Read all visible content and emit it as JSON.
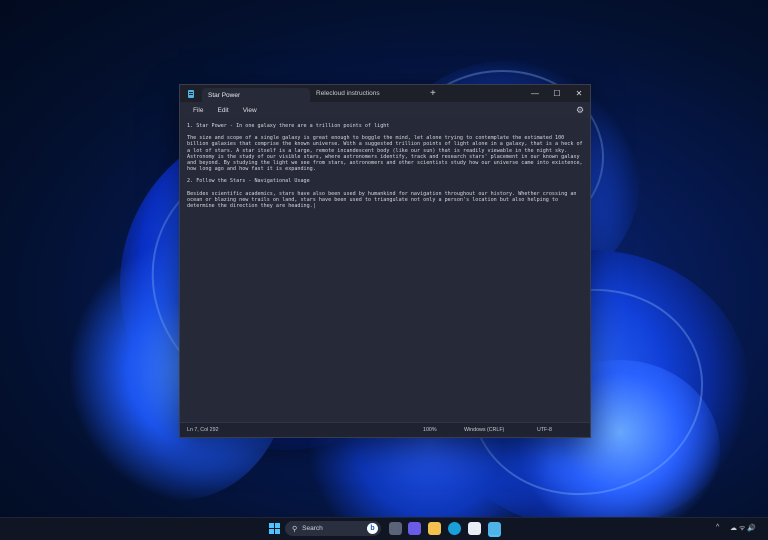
{
  "window": {
    "tabs": [
      {
        "label": "Star Power",
        "active": true
      },
      {
        "label": "Relecloud instructions",
        "active": false
      }
    ],
    "new_tab": "+",
    "controls": {
      "minimize": "—",
      "maximize": "☐",
      "close": "✕"
    }
  },
  "menu": [
    "File",
    "Edit",
    "View"
  ],
  "settings_icon": "⚙",
  "document": {
    "paragraphs": [
      "1. Star Power - In one galaxy there are a trillion points of light",
      "The size and scope of a single galaxy is great enough to boggle the mind, let alone trying to contemplate the estimated 100 billion galaxies that comprise the known universe. With a suggested trillion points of light alone in a galaxy, that is a heck of a lot of stars. A star itself is a large, remote incandescent body (like our sun) that is readily viewable in the night sky. Astronomy is the study of our visible stars, where astronomers identify, track and research stars' placement in our known galaxy and beyond. By studying the light we see from stars, astronomers and other scientists study how our universe came into existence, how long ago and how fast it is expanding.",
      "2. Follow the Stars - Navigational Usage",
      "Besides scientific academics, stars have also been used by humankind for navigation throughout our history. Whether crossing an ocean or blazing new trails on land, stars have been used to triangulate not only a person's location but also helping to determine the direction they are heading.|"
    ]
  },
  "status": {
    "position": "Ln 7, Col 292",
    "zoom": "100%",
    "line_ending": "Windows (CRLF)",
    "encoding": "UTF-8"
  },
  "taskbar": {
    "search_placeholder": "Search",
    "bing": "b",
    "tray": {
      "chevron": "^",
      "icons": "☁ ᯤ 🔊"
    }
  },
  "colors": {
    "accent": "#4cc2ff",
    "window_bg": "#272a38",
    "titlebar_bg": "#1e2029"
  }
}
